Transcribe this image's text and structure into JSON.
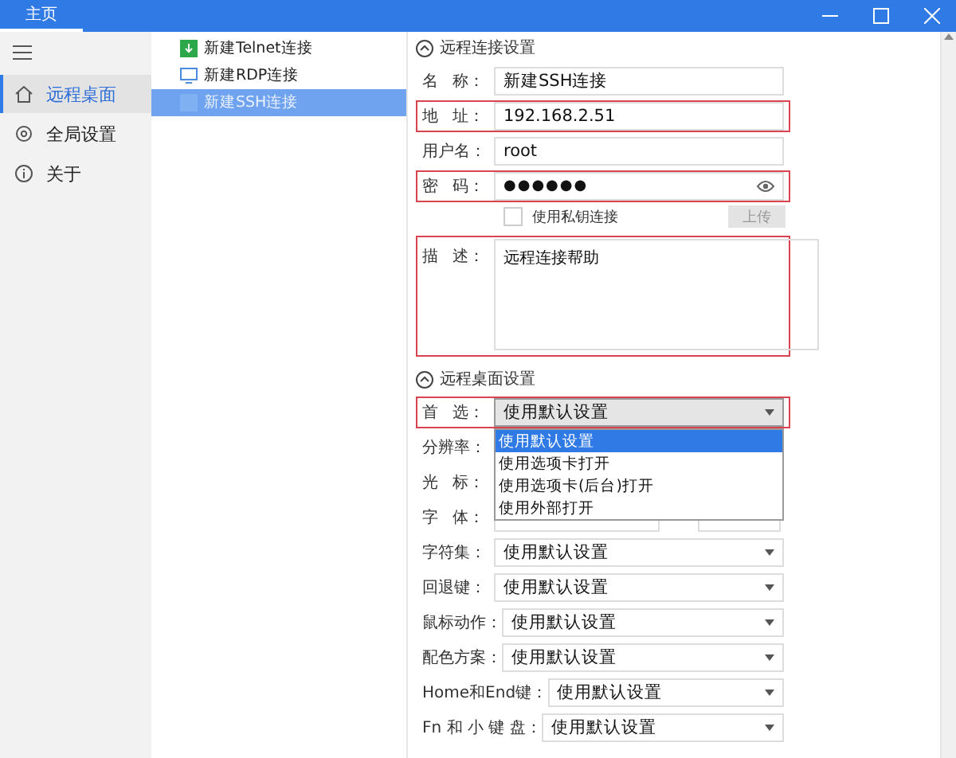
{
  "title_tab": {
    "label": "主页",
    "selected": true
  },
  "nav": {
    "items": [
      {
        "label": "远程桌面",
        "selected": true
      },
      {
        "label": "全局设置",
        "selected": false
      },
      {
        "label": "关于",
        "selected": false
      }
    ]
  },
  "connections": [
    {
      "kind": "telnet",
      "label": "新建Telnet连接",
      "selected": false
    },
    {
      "kind": "rdp",
      "label": "新建RDP连接",
      "selected": false
    },
    {
      "kind": "ssh",
      "label": "新建SSH连接",
      "selected": true
    }
  ],
  "connection_settings": {
    "title": "远程连接设置",
    "expanded": true,
    "fields": [
      {
        "kind": "text",
        "label": "名 称：",
        "value": "新建SSH连接",
        "highlighted": false
      },
      {
        "kind": "text",
        "label": "地 址：",
        "value": "192.168.2.51",
        "highlighted": true
      },
      {
        "kind": "text",
        "label": "用户名：",
        "value": "root",
        "highlighted": false
      },
      {
        "kind": "password",
        "label": "密 码：",
        "value": "●●●●●●",
        "highlighted": true
      }
    ],
    "private_key": {
      "label": "使用私钥连接",
      "checked": false
    },
    "upload_button": {
      "label": "上传",
      "disabled": true
    },
    "description": {
      "label": "描 述：",
      "value": "远程连接帮助",
      "highlighted": true
    }
  },
  "desktop_settings": {
    "title": "远程桌面设置",
    "expanded": true,
    "rows": [
      {
        "kind": "select",
        "label": "首 选：",
        "value": "使用默认设置",
        "highlighted": true,
        "open": true,
        "options": [
          {
            "label": "使用默认设置",
            "selected": true
          },
          {
            "label": "使用选项卡打开",
            "selected": false
          },
          {
            "label": "使用选项卡(后台)打开",
            "selected": false
          },
          {
            "label": "使用外部打开",
            "selected": false
          }
        ]
      },
      {
        "kind": "covered",
        "label": "分辨率："
      },
      {
        "kind": "covered",
        "label": "光 标："
      },
      {
        "kind": "split",
        "label": "字 体："
      },
      {
        "kind": "select",
        "label": "字符集：",
        "value": "使用默认设置"
      },
      {
        "kind": "select",
        "label": "回退键：",
        "value": "使用默认设置"
      },
      {
        "kind": "select",
        "label": "鼠标动作：",
        "value": "使用默认设置"
      },
      {
        "kind": "select",
        "label": "配色方案：",
        "value": "使用默认设置"
      },
      {
        "kind": "select",
        "label": "Home和End键：",
        "value": "使用默认设置"
      },
      {
        "kind": "select",
        "label": "Fn 和 小 键 盘：",
        "value": "使用默认设置"
      }
    ]
  }
}
